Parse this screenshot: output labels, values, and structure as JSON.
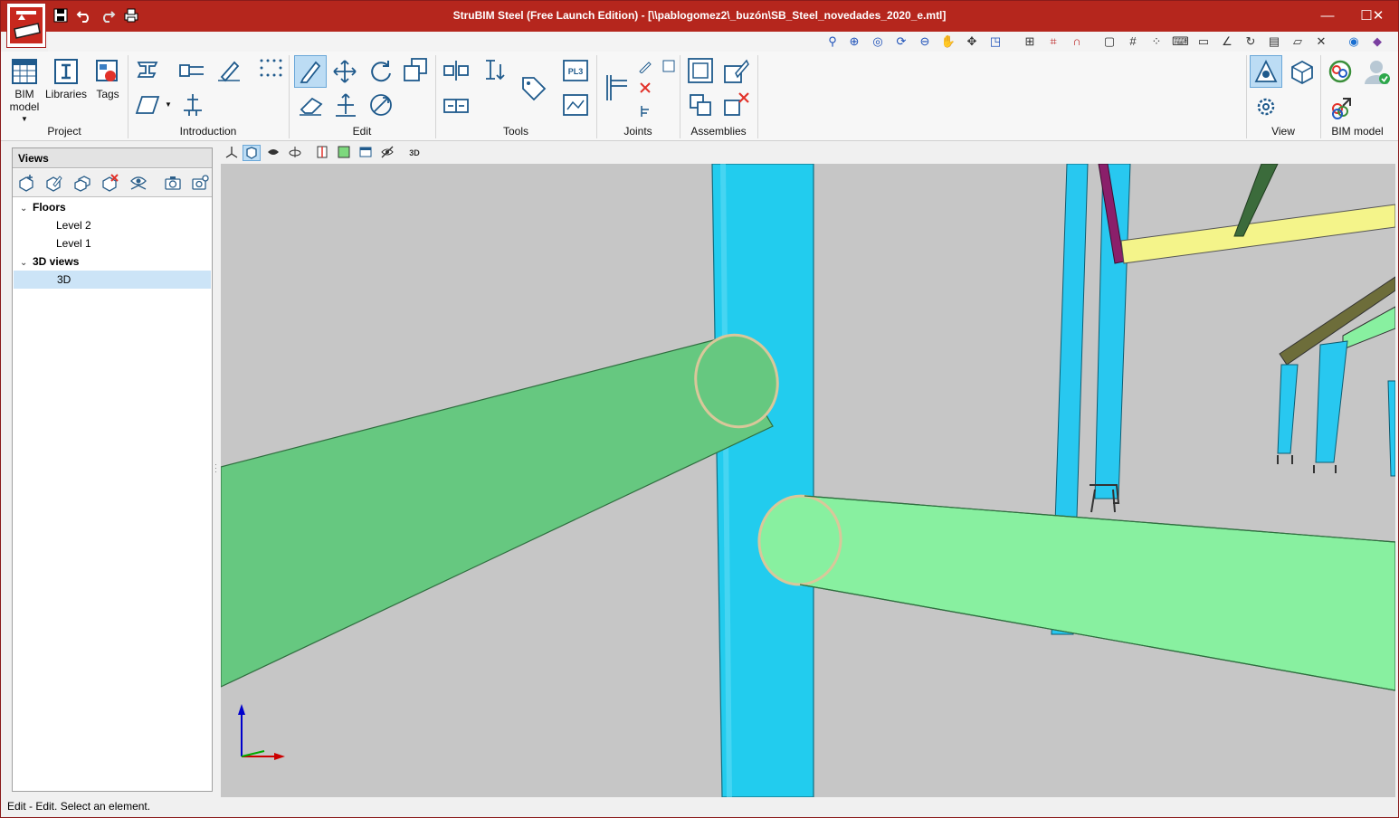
{
  "window": {
    "title": "StruBIM Steel (Free Launch Edition) - [\\\\pablogomez2\\_buzón\\SB_Steel_novedades_2020_e.mtl]",
    "controls": {
      "minimize": "—",
      "maximize": "☐",
      "close": "✕"
    }
  },
  "quick_access": [
    {
      "name": "save-icon",
      "glyph": "💾"
    },
    {
      "name": "undo-icon",
      "glyph": "↶"
    },
    {
      "name": "redo-icon",
      "glyph": "↷"
    },
    {
      "name": "print-icon",
      "glyph": "⎙"
    }
  ],
  "ribbon": {
    "groups": {
      "project": "Project",
      "introduction": "Introduction",
      "edit": "Edit",
      "tools": "Tools",
      "joints": "Joints",
      "assemblies": "Assemblies",
      "view": "View",
      "bim_model": "BIM model"
    },
    "buttons": {
      "bim_model": "BIM model",
      "libraries": "Libraries",
      "tags": "Tags"
    },
    "pl3_label": "PL3"
  },
  "views_panel": {
    "title": "Views",
    "tree": {
      "floors": "Floors",
      "level2": "Level 2",
      "level1": "Level 1",
      "views3d": "3D views",
      "view3d": "3D"
    }
  },
  "viewport": {
    "toolbar_3d_label": "3D",
    "colors": {
      "background": "#c6c6c6",
      "column": "#22ccee",
      "brace_left": "#66c880",
      "brace_right": "#88f0a0",
      "beam_yellow": "#f4f48a",
      "member_purple": "#8a1f6a"
    }
  },
  "status_bar": {
    "text": "Edit - Edit. Select an element."
  }
}
